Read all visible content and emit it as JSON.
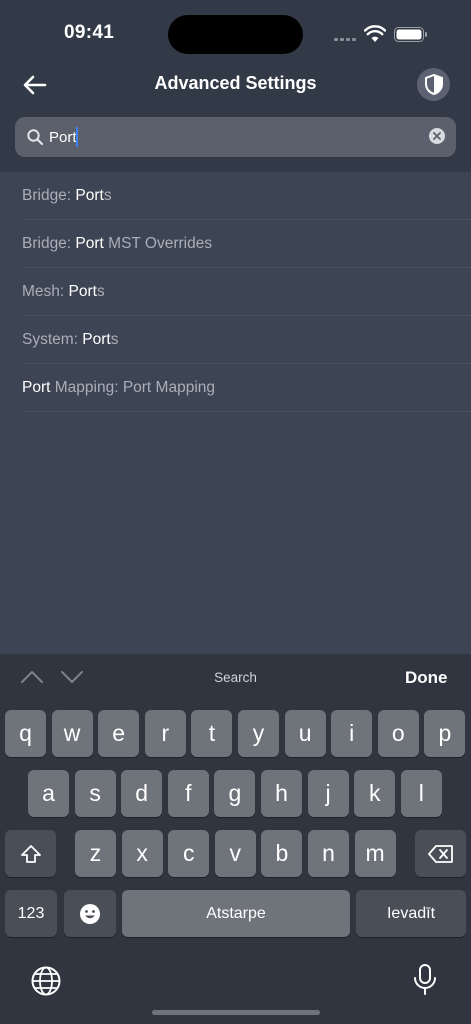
{
  "status_bar": {
    "time": "09:41"
  },
  "header": {
    "title": "Advanced Settings"
  },
  "search": {
    "value": "Port"
  },
  "results": [
    {
      "segments": [
        {
          "text": "Bridge: ",
          "hl": false
        },
        {
          "text": "Port",
          "hl": true
        },
        {
          "text": "s",
          "hl": false
        }
      ]
    },
    {
      "segments": [
        {
          "text": "Bridge: ",
          "hl": false
        },
        {
          "text": "Port",
          "hl": true
        },
        {
          "text": " MST Overrides",
          "hl": false
        }
      ]
    },
    {
      "segments": [
        {
          "text": "Mesh: ",
          "hl": false
        },
        {
          "text": "Port",
          "hl": true
        },
        {
          "text": "s",
          "hl": false
        }
      ]
    },
    {
      "segments": [
        {
          "text": "System: ",
          "hl": false
        },
        {
          "text": "Port",
          "hl": true
        },
        {
          "text": "s",
          "hl": false
        }
      ]
    },
    {
      "segments": [
        {
          "text": "Port",
          "hl": true
        },
        {
          "text": " Mapping: Port Mapping",
          "hl": false
        }
      ]
    }
  ],
  "accessory": {
    "label": "Search",
    "done": "Done"
  },
  "keyboard": {
    "row1": [
      "q",
      "w",
      "e",
      "r",
      "t",
      "y",
      "u",
      "i",
      "o",
      "p"
    ],
    "row2": [
      "a",
      "s",
      "d",
      "f",
      "g",
      "h",
      "j",
      "k",
      "l"
    ],
    "row3": [
      "z",
      "x",
      "c",
      "v",
      "b",
      "n",
      "m"
    ],
    "numbers_label": "123",
    "space_label": "Atstarpe",
    "return_label": "Ievadīt"
  },
  "colors": {
    "background": "#3d4453",
    "header": "#333a47",
    "highlight": "#ffffff",
    "muted_text": "#a9aeb8",
    "caret": "#3b82f6"
  }
}
